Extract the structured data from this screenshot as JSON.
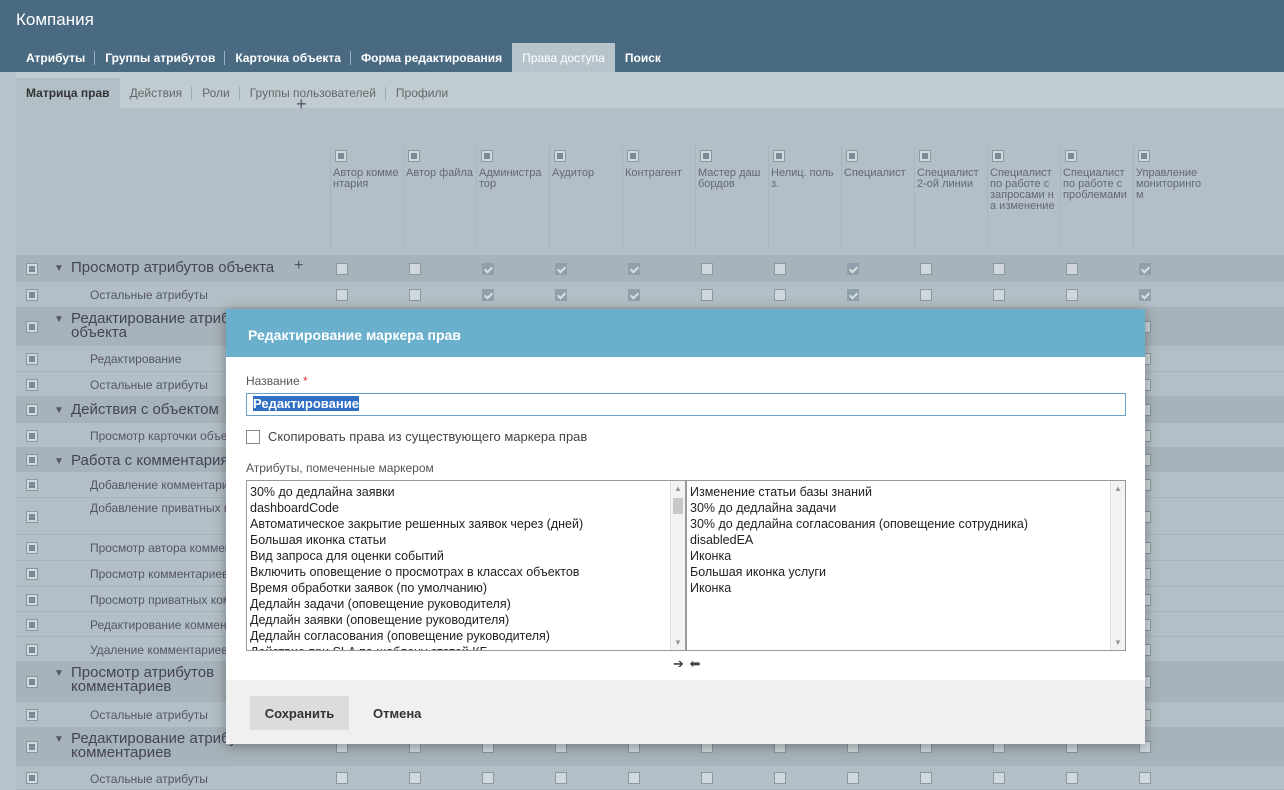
{
  "header": {
    "title": "Компания"
  },
  "tabs": [
    {
      "label": "Атрибуты"
    },
    {
      "label": "Группы атрибутов"
    },
    {
      "label": "Карточка объекта"
    },
    {
      "label": "Форма редактирования"
    },
    {
      "label": "Права доступа"
    },
    {
      "label": "Поиск"
    }
  ],
  "subtabs": [
    {
      "label": "Матрица прав"
    },
    {
      "label": "Действия"
    },
    {
      "label": "Роли"
    },
    {
      "label": "Группы пользователей"
    },
    {
      "label": "Профили"
    }
  ],
  "matrix": {
    "columns": [
      "Автор комментария",
      "Автор файла",
      "Администратор",
      "Аудитор",
      "Контрагент",
      "Мастер дашбордов",
      "Нелиц. польз.",
      "Специалист",
      "Специалист 2-ой линии",
      "Специалист по работе с запросами на изменение",
      "Специалист по работе с проблемами",
      "Управление мониторингом"
    ],
    "rows": [
      {
        "label": "Просмотр атрибутов объекта",
        "group": true,
        "checked": [
          false,
          false,
          true,
          true,
          true,
          false,
          false,
          true,
          false,
          false,
          false,
          true
        ]
      },
      {
        "label": "Остальные атрибуты",
        "group": false,
        "checked": [
          false,
          false,
          true,
          true,
          true,
          false,
          false,
          true,
          false,
          false,
          false,
          true
        ]
      },
      {
        "label": "Редактирование атрибутов объекта",
        "group": true
      },
      {
        "label": "Редактирование",
        "group": false
      },
      {
        "label": "Остальные атрибуты",
        "group": false
      },
      {
        "label": "Действия с объектом",
        "group": true
      },
      {
        "label": "Просмотр карточки объекта",
        "group": false
      },
      {
        "label": "Работа с комментариями",
        "group": true
      },
      {
        "label": "Добавление комментария",
        "group": false
      },
      {
        "label": "Добавление приватных комментариев",
        "group": false
      },
      {
        "label": "Просмотр автора комментария",
        "group": false
      },
      {
        "label": "Просмотр комментариев",
        "group": false
      },
      {
        "label": "Просмотр приватных комментариев",
        "group": false
      },
      {
        "label": "Редактирование комментариев",
        "group": false
      },
      {
        "label": "Удаление комментариев",
        "group": false
      },
      {
        "label": "Просмотр атрибутов комментариев",
        "group": true
      },
      {
        "label": "Остальные атрибуты",
        "group": false
      },
      {
        "label": "Редактирование атрибутов комментариев",
        "group": true
      },
      {
        "label": "Остальные атрибуты",
        "group": false
      }
    ]
  },
  "modal": {
    "title": "Редактирование маркера прав",
    "name_label": "Название",
    "required_mark": "*",
    "name_value": "Редактирование",
    "copy_label": "Скопировать права из существующего маркера прав",
    "attrs_label": "Атрибуты, помеченные маркером",
    "left_list": [
      "30% до дедлайна заявки",
      "dashboardCode",
      "Автоматическое закрытие решенных заявок через (дней)",
      "Большая иконка статьи",
      "Вид запроса для оценки событий",
      "Включить оповещение о просмотрах в классах объектов",
      "Время обработки заявок (по умолчанию)",
      "Дедлайн задачи (оповещение руководителя)",
      "Дедлайн заявки (оповещение руководителя)",
      "Дедлайн согласования (оповещение руководителя)",
      "Действие при SLA по шаблону статей КБ"
    ],
    "right_list": [
      "Изменение статьи базы знаний",
      "30% до дедлайна задачи",
      "30% до дедлайна согласования (оповещение сотрудника)",
      "disabledEA",
      "Иконка",
      "Большая иконка услуги",
      "Иконка"
    ],
    "move_buttons": "➔ ⬅",
    "save": "Сохранить",
    "cancel": "Отмена"
  }
}
